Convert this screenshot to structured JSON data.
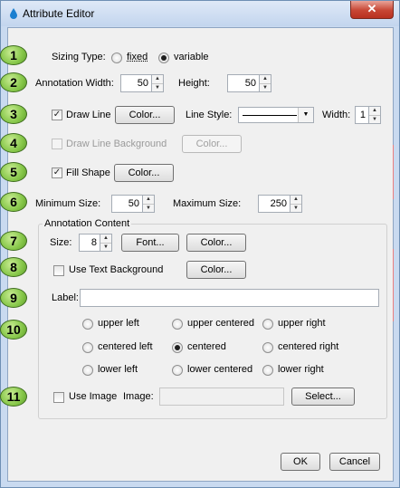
{
  "window": {
    "title": "Attribute Editor",
    "close_glyph": "✕"
  },
  "callouts": [
    "1",
    "2",
    "3",
    "4",
    "5",
    "6",
    "7",
    "8",
    "9",
    "10",
    "11"
  ],
  "sizing": {
    "label": "Sizing Type:",
    "fixed": "fixed",
    "variable": "variable",
    "selected": "variable"
  },
  "annotation_width": {
    "label": "Annotation Width:",
    "value": "50"
  },
  "height": {
    "label": "Height:",
    "value": "50"
  },
  "draw_line": {
    "label": "Draw Line",
    "checked": true,
    "color_button": "Color...",
    "line_style_label": "Line Style:",
    "width_label": "Width:",
    "width_value": "1"
  },
  "draw_line_background": {
    "label": "Draw Line Background",
    "checked": false,
    "color_button": "Color..."
  },
  "fill_shape": {
    "label": "Fill Shape",
    "checked": true,
    "color_button": "Color..."
  },
  "minimum_size": {
    "label": "Minimum Size:",
    "value": "50"
  },
  "maximum_size": {
    "label": "Maximum Size:",
    "value": "250"
  },
  "annotation_content": {
    "title": "Annotation Content",
    "size_label": "Size:",
    "size_value": "8",
    "font_button": "Font...",
    "color_button": "Color...",
    "use_text_background": {
      "label": "Use Text Background",
      "checked": false,
      "color_button": "Color..."
    },
    "label_field": {
      "label": "Label:",
      "value": ""
    },
    "positions": {
      "upper_left": "upper left",
      "upper_centered": "upper centered",
      "upper_right": "upper right",
      "centered_left": "centered left",
      "centered": "centered",
      "centered_right": "centered right",
      "lower_left": "lower left",
      "lower_centered": "lower centered",
      "lower_right": "lower right",
      "selected": "centered"
    },
    "use_image": {
      "label": "Use Image",
      "checked": false,
      "image_label": "Image:",
      "image_value": "",
      "select_button": "Select..."
    }
  },
  "footer": {
    "ok": "OK",
    "cancel": "Cancel"
  },
  "colors": {
    "title_bar": "#c9daf0",
    "close_button": "#c74634",
    "callout": "#85c648",
    "dialog_bg": "#f0f0f0"
  }
}
